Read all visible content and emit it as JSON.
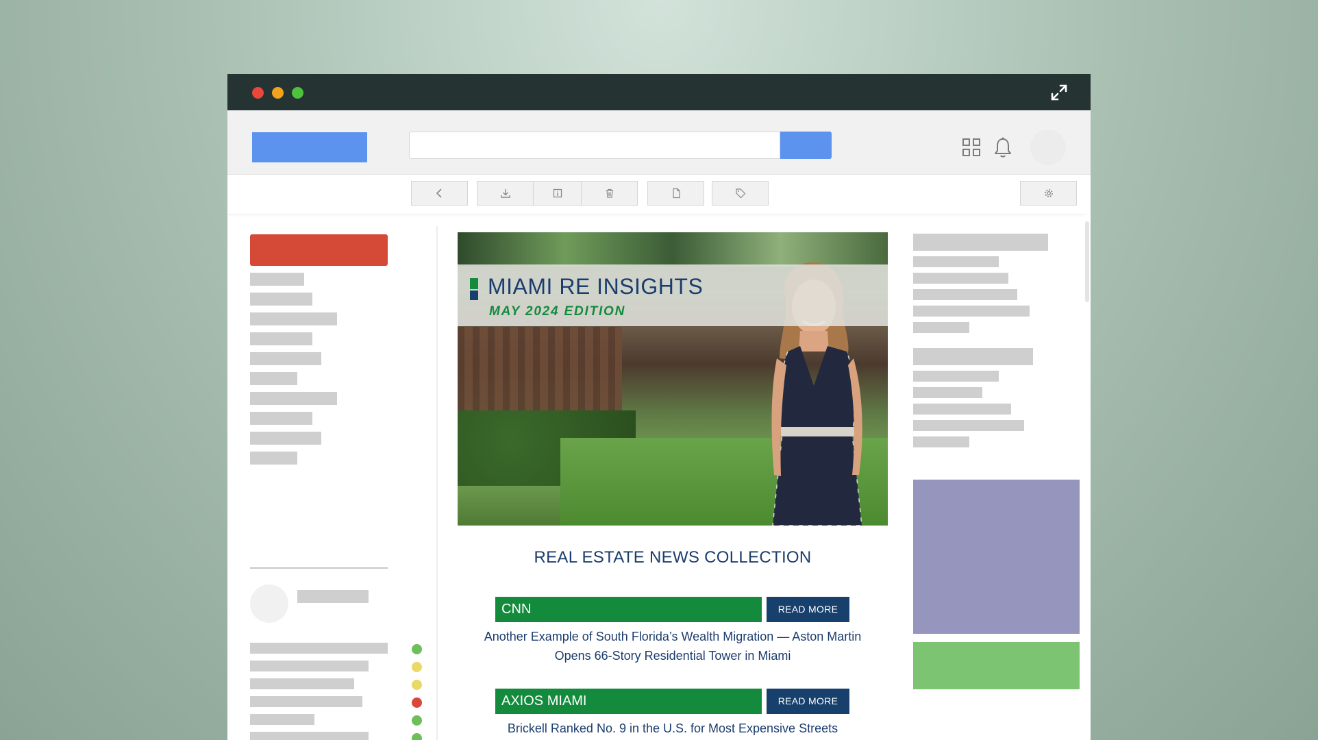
{
  "window": {
    "controls": [
      "close",
      "minimize",
      "maximize"
    ],
    "expand_icon": "expand-arrows-icon"
  },
  "toolbar": {
    "search": {
      "value": "",
      "placeholder": ""
    },
    "icons": [
      "apps-grid-icon",
      "bell-icon",
      "avatar"
    ]
  },
  "actions": {
    "icons": [
      "back-arrow-icon",
      "archive-icon",
      "info-icon",
      "trash-icon",
      "document-icon",
      "tag-icon",
      "settings-gear-icon"
    ]
  },
  "status_dots": [
    "#6cbf5a",
    "#ead867",
    "#ead867",
    "#d9463a",
    "#6cbf5a",
    "#6cbf5a",
    "#ead867"
  ],
  "email": {
    "banner": {
      "title": "MIAMI RE INSIGHTS",
      "subtitle": "MAY 2024 EDITION"
    },
    "section_title": "REAL ESTATE NEWS COLLECTION",
    "news": [
      {
        "source": "CNN",
        "button": "READ MORE",
        "headline": "Another Example of South Florida’s Wealth Migration — Aston Martin Opens 66-Story Residential Tower in Miami"
      },
      {
        "source": "AXIOS MIAMI",
        "button": "READ MORE",
        "headline": "Brickell Ranked No. 9 in the U.S. for Most Expensive Streets"
      }
    ]
  },
  "colors": {
    "brand_green": "#138a3c",
    "brand_navy": "#17406c",
    "accent_blue": "#5b93ef",
    "compose_red": "#d44a36",
    "ad_purple": "#9595bd",
    "ad_green": "#7cc472"
  }
}
